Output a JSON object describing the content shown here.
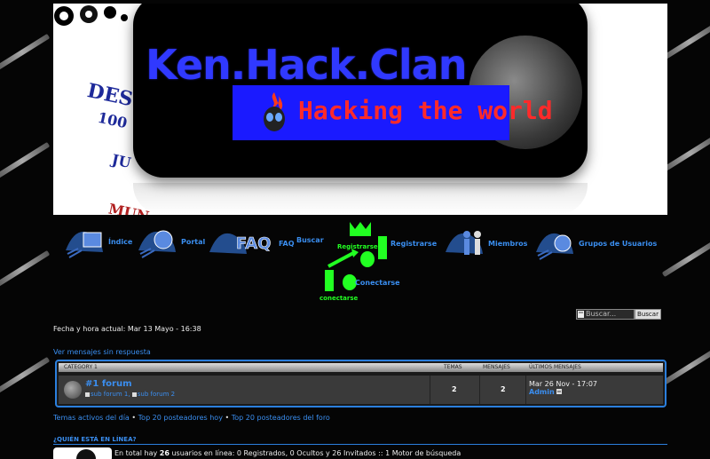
{
  "banner": {
    "title": "Ken.Hack.Clan",
    "subtitle": "Hacking the world",
    "side_text_1": "DESC",
    "side_text_2": "100",
    "side_text_3": "JU",
    "side_text_4": "MUN"
  },
  "nav": {
    "items": [
      {
        "label": "Índice",
        "icon": "home-icon"
      },
      {
        "label": "Portal",
        "icon": "portal-icon"
      },
      {
        "label": "FAQ",
        "icon": "faq-icon"
      },
      {
        "label": "Buscar",
        "icon": "search-icon"
      },
      {
        "label": "Registrarse",
        "icon": "register-icon"
      },
      {
        "label": "Registrarse",
        "icon": "register-icon"
      },
      {
        "label": "Miembros",
        "icon": "members-icon"
      },
      {
        "label": "Grupos de Usuarios",
        "icon": "groups-icon"
      },
      {
        "label": "conectarse",
        "icon": "login-icon"
      },
      {
        "label": "Conectarse",
        "icon": "login-icon"
      }
    ],
    "faq_word": "FAQ"
  },
  "datetime": "Fecha y hora actual: Mar 13 Mayo - 16:38",
  "search": {
    "placeholder": "Buscar...",
    "button": "Buscar"
  },
  "unanswered_link": "Ver mensajes sin respuesta",
  "forum_table": {
    "category": "CATEGORY 1",
    "col_topics": "TEMAS",
    "col_posts": "MENSAJES",
    "col_last": "ÚLTIMOS MENSAJES",
    "rows": [
      {
        "title": "#1 forum",
        "subforums": [
          "sub forum 1",
          "sub forum 2"
        ],
        "topics": "2",
        "posts": "2",
        "last_date": "Mar 26 Nov - 17:07",
        "last_author": "Admin"
      }
    ]
  },
  "links": {
    "active_topics": "Temas activos del día",
    "top_week": "Top 20 posteadores hoy",
    "top_all": "Top 20 posteadores del foro"
  },
  "whos_online": {
    "title": "¿QUIÉN ESTÁ EN LÍNEA?",
    "text_pre": "En total hay ",
    "count": "26",
    "text_post": " usuarios en línea: 0 Registrados, 0 Ocultos y 26 Invitados :: 1 Motor de búsqueda"
  },
  "colors": {
    "accent": "#3a8ef0",
    "banner_blue": "#3039ff",
    "subtitle_red": "#ff2a2a",
    "neon_green": "#22ff22"
  }
}
